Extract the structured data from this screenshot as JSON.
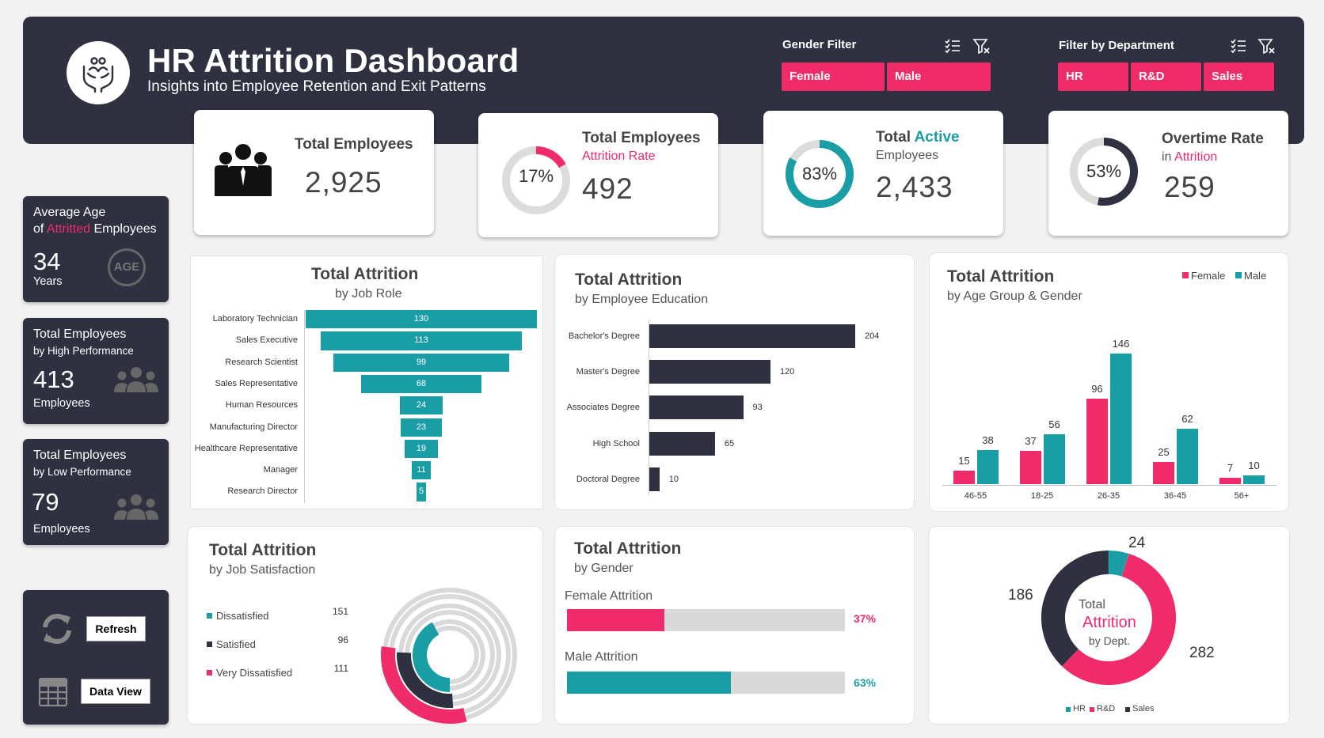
{
  "header": {
    "title": "HR Attrition Dashboard",
    "subtitle": "Insights into Employee Retention and Exit Patterns",
    "gender_filter_label": "Gender Filter",
    "gender_options": [
      "Female",
      "Male"
    ],
    "dept_filter_label": "Filter by Department",
    "dept_options": [
      "HR",
      "R&D",
      "Sales"
    ]
  },
  "kpis": {
    "total_employees": {
      "label": "Total Employees",
      "value": "2,925"
    },
    "attrition": {
      "label": "Total Employees",
      "sub": "Attrition Rate",
      "percent": "17%",
      "percent_value": 17,
      "value": "492"
    },
    "active": {
      "label_a": "Total ",
      "label_b": "Active",
      "sub": "Employees",
      "percent": "83%",
      "percent_value": 83,
      "value": "2,433"
    },
    "overtime": {
      "label": "Overtime Rate",
      "sub_a": "in ",
      "sub_b": "Attrition",
      "percent": "53%",
      "percent_value": 53,
      "value": "259"
    }
  },
  "side": {
    "age": {
      "line1": "Average Age",
      "line2_a": "of ",
      "line2_b": "Attritted",
      "line2_c": " Employees",
      "value": "34",
      "unit": "Years",
      "icon_text": "AGE"
    },
    "high": {
      "line1": "Total Employees",
      "line2": "by High Performance",
      "value": "413",
      "unit": "Employees"
    },
    "low": {
      "line1": "Total Employees",
      "line2": "by Low Performance",
      "value": "79",
      "unit": "Employees"
    },
    "refresh_label": "Refresh",
    "data_view_label": "Data View"
  },
  "panels": {
    "job_role": {
      "title": "Total Attrition",
      "sub": "by Job Role"
    },
    "education": {
      "title": "Total Attrition",
      "sub": "by Employee Education"
    },
    "age_gender": {
      "title": "Total Attrition",
      "sub": "by Age Group & Gender",
      "legend": [
        "Female",
        "Male"
      ]
    },
    "satisfaction": {
      "title": "Total Attrition",
      "sub": "by Job Satisfaction"
    },
    "gender": {
      "title": "Total Attrition",
      "sub": "by Gender",
      "female_label": "Female Attrition",
      "male_label": "Male Attrition",
      "female_pct": "37%",
      "male_pct": "63%",
      "female_value": 37,
      "male_value": 63
    },
    "dept": {
      "center_1": "Total",
      "center_2": "Attrition",
      "center_3": "by Dept.",
      "legend": [
        "HR",
        "R&D",
        "Sales"
      ]
    }
  },
  "chart_data": [
    {
      "type": "bar",
      "title": "Total Attrition",
      "subtitle": "by Job Role",
      "categories": [
        "Laboratory Technician",
        "Sales Executive",
        "Research Scientist",
        "Sales Representative",
        "Human Resources",
        "Manufacturing Director",
        "Healthcare Representative",
        "Manager",
        "Research Director"
      ],
      "values": [
        130,
        113,
        99,
        68,
        24,
        23,
        19,
        11,
        5
      ],
      "labels": [
        "130",
        "113",
        "99",
        "68",
        "24",
        "23",
        "19",
        "11",
        "5"
      ],
      "color": "#1a9ea5"
    },
    {
      "type": "bar",
      "title": "Total Attrition",
      "subtitle": "by Employee Education",
      "categories": [
        "Bachelor's Degree",
        "Master's Degree",
        "Associates Degree",
        "High School",
        "Doctoral Degree"
      ],
      "values": [
        204,
        120,
        93,
        65,
        10
      ],
      "labels": [
        "204",
        "120",
        "93",
        "65",
        "10"
      ],
      "color": "#2f3040"
    },
    {
      "type": "bar",
      "title": "Total Attrition",
      "subtitle": "by Age Group & Gender",
      "categories": [
        "46-55",
        "18-25",
        "26-35",
        "36-45",
        "56+"
      ],
      "series": [
        {
          "name": "Female",
          "values": [
            15,
            37,
            96,
            25,
            7
          ],
          "labels": [
            "15",
            "37",
            "96",
            "25",
            "7"
          ],
          "color": "#ef2b6a"
        },
        {
          "name": "Male",
          "values": [
            38,
            56,
            146,
            62,
            10
          ],
          "labels": [
            "38",
            "56",
            "146",
            "62",
            "10"
          ],
          "color": "#1a9ea5"
        }
      ]
    },
    {
      "type": "pie",
      "title": "Total Attrition",
      "subtitle": "by Job Satisfaction",
      "categories": [
        "Dissatisfied",
        "Satisfied",
        "Very Dissatisfied"
      ],
      "values": [
        151,
        96,
        111
      ],
      "labels": [
        "151",
        "96",
        "111"
      ],
      "colors": [
        "#1a9ea5",
        "#2f3040",
        "#ef2b6a"
      ]
    },
    {
      "type": "pie",
      "title": "Total Attrition by Dept.",
      "categories": [
        "HR",
        "R&D",
        "Sales"
      ],
      "values": [
        24,
        282,
        186
      ],
      "labels": [
        "24",
        "282",
        "186"
      ],
      "colors": [
        "#1a9ea5",
        "#ef2b6a",
        "#2f3040"
      ]
    }
  ]
}
